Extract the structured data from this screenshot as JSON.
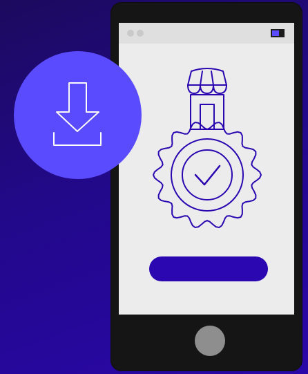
{
  "scene": {
    "colors": {
      "background_start": "#1c0a5e",
      "background_end": "#2a07a8",
      "phone_body": "#151515",
      "screen": "#ececec",
      "accent": "#5b4bff",
      "cta": "#2a07b0",
      "line_art": "#2a07b0",
      "home_button": "#8e8e8e"
    },
    "icons": {
      "download": "download-arrow-icon",
      "badge": "verified-store-badge-icon",
      "check": "checkmark-icon",
      "store": "storefront-awning-icon"
    }
  }
}
